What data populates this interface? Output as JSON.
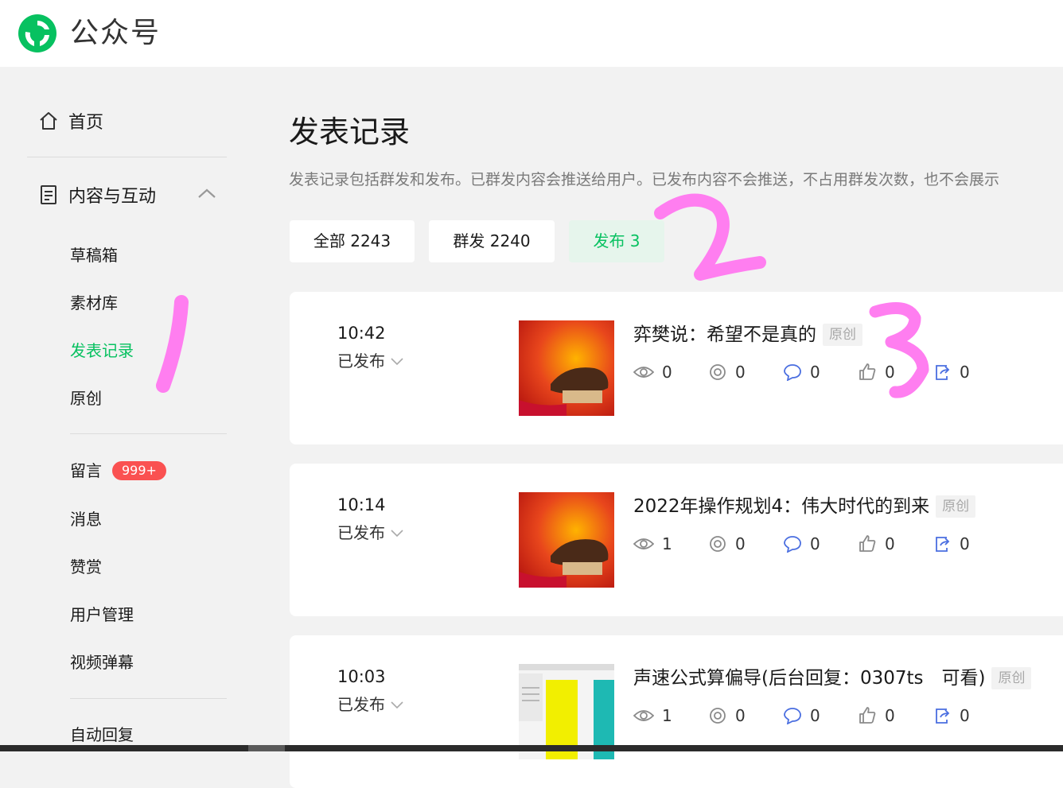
{
  "app": {
    "title": "公众号"
  },
  "sidebar": {
    "home": "首页",
    "content_section": "内容与互动",
    "content_items": [
      "草稿箱",
      "素材库",
      "发表记录",
      "原创"
    ],
    "interaction_items": [
      "留言",
      "消息",
      "赞赏",
      "用户管理",
      "视频弹幕"
    ],
    "comment_badge": "999+",
    "auto_reply": "自动回复"
  },
  "main": {
    "title": "发表记录",
    "description": "发表记录包括群发和发布。已群发内容会推送给用户。已发布内容不会推送，不占用群发次数，也不会展示",
    "tabs": [
      {
        "label": "全部 2243",
        "active": false
      },
      {
        "label": "群发 2240",
        "active": false
      },
      {
        "label": "发布 3",
        "active": true
      }
    ],
    "records": [
      {
        "time": "10:42",
        "status": "已发布",
        "title": "弈樊说：希望不是真的",
        "tag": "原创",
        "views": "0",
        "shares_circle": "0",
        "comments": "0",
        "likes": "0",
        "forwards": "0",
        "thumbnail": "bull-red-image"
      },
      {
        "time": "10:14",
        "status": "已发布",
        "title": "2022年操作规划4：伟大时代的到来",
        "tag": "原创",
        "views": "1",
        "shares_circle": "0",
        "comments": "0",
        "likes": "0",
        "forwards": "0",
        "thumbnail": "bull-red-image"
      },
      {
        "time": "10:03",
        "status": "已发布",
        "title": "声速公式算偏导(后台回复：0307ts　可看)",
        "tag": "原创",
        "views": "1",
        "shares_circle": "0",
        "comments": "0",
        "likes": "0",
        "forwards": "0",
        "thumbnail": "spreadsheet-image"
      }
    ]
  },
  "colors": {
    "brand_green": "#07c160",
    "badge_red": "#fa5151",
    "annotation_pink": "#ff7ef0"
  },
  "icons": [
    "logo-icon",
    "home-icon",
    "document-icon",
    "chevron-up-icon",
    "chevron-down-icon",
    "eye-icon",
    "share-circle-icon",
    "comment-icon",
    "thumbs-up-icon",
    "forward-icon"
  ]
}
